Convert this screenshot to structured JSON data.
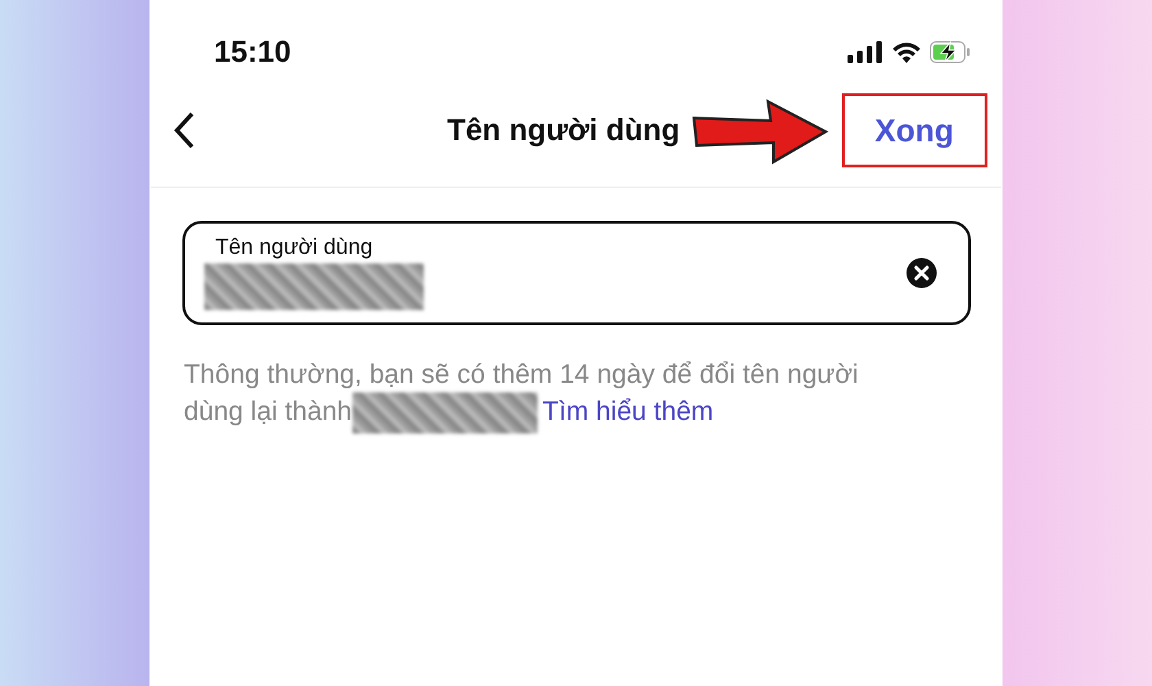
{
  "status_bar": {
    "time": "15:10"
  },
  "nav": {
    "title": "Tên người dùng",
    "action": {
      "label": "Xong",
      "highlighted": true
    }
  },
  "field": {
    "label": "Tên người dùng",
    "value_redacted": true
  },
  "helper": {
    "text": "Thông thường, bạn sẽ có thêm 14 ngày để đổi tên người dùng lại thành",
    "redacted": true,
    "link": "Tìm hiểu thêm"
  }
}
